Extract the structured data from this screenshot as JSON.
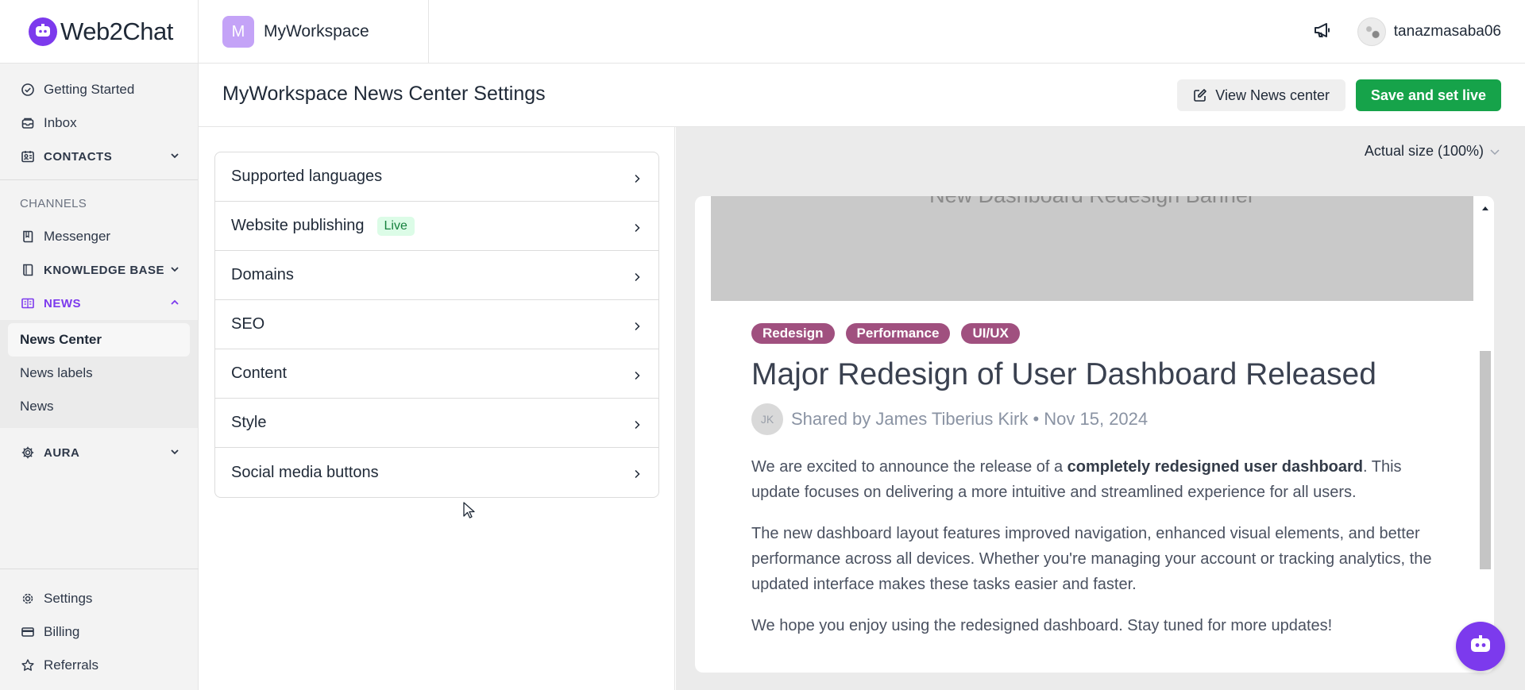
{
  "brand": {
    "name": "Web2Chat",
    "color": "#7c3aed"
  },
  "workspace": {
    "initial": "M",
    "name": "MyWorkspace"
  },
  "user": {
    "name": "tanazmasaba06"
  },
  "sidebar": {
    "top_items": [
      {
        "label": "Getting Started",
        "icon": "check-circle-icon"
      },
      {
        "label": "Inbox",
        "icon": "inbox-icon"
      }
    ],
    "contacts": {
      "label": "CONTACTS",
      "icon": "contacts-icon"
    },
    "channels_label": "CHANNELS",
    "messenger": {
      "label": "Messenger",
      "icon": "messenger-icon"
    },
    "knowledge_base": {
      "label": "KNOWLEDGE BASE",
      "icon": "book-icon"
    },
    "news": {
      "label": "NEWS",
      "icon": "news-icon"
    },
    "news_sub": [
      {
        "label": "News Center",
        "active": true
      },
      {
        "label": "News labels"
      },
      {
        "label": "News"
      }
    ],
    "aura": {
      "label": "AURA",
      "icon": "gear-icon"
    },
    "bottom_items": [
      {
        "label": "Settings",
        "icon": "settings-icon"
      },
      {
        "label": "Billing",
        "icon": "billing-icon"
      },
      {
        "label": "Referrals",
        "icon": "star-icon"
      }
    ]
  },
  "header": {
    "title": "MyWorkspace News Center Settings",
    "view_label": "View News center",
    "save_label": "Save and set live",
    "save_color": "#16a34a"
  },
  "settings": {
    "rows": [
      {
        "label": "Supported languages"
      },
      {
        "label": "Website publishing",
        "badge": "Live"
      },
      {
        "label": "Domains"
      },
      {
        "label": "SEO"
      },
      {
        "label": "Content"
      },
      {
        "label": "Style"
      },
      {
        "label": "Social media buttons"
      }
    ]
  },
  "preview": {
    "zoom": "Actual size (100%)",
    "banner_text": "New Dashboard Redesign Banner",
    "tags": [
      "Redesign",
      "Performance",
      "UI/UX"
    ],
    "tag_color": "#a0507f",
    "title": "Major Redesign of User Dashboard Released",
    "author_initials": "JK",
    "meta": "Shared by James Tiberius Kirk • Nov 15, 2024",
    "p1_before": "We are excited to announce the release of a ",
    "p1_bold": "completely redesigned user dashboard",
    "p1_after": ". This update focuses on delivering a more intuitive and streamlined experience for all users.",
    "p2": "The new dashboard layout features improved navigation, enhanced visual elements, and better performance across all devices. Whether you're managing your account or tracking analytics, the updated interface makes these tasks easier and faster.",
    "p3": "We hope you enjoy using the redesigned dashboard. Stay tuned for more updates!"
  }
}
